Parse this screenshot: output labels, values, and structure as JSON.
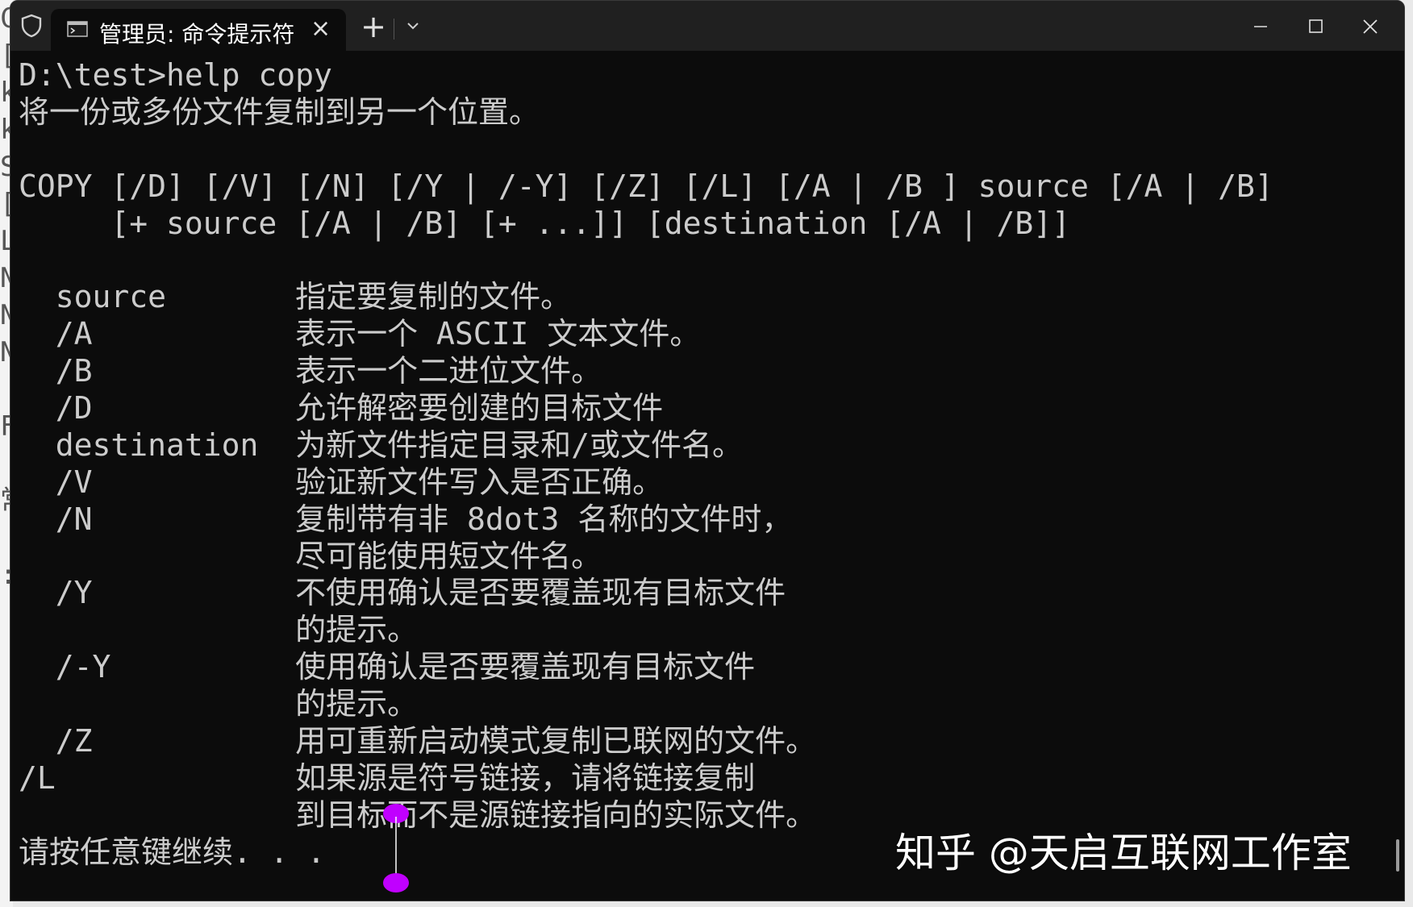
{
  "background_strip": [
    "C",
    "[",
    "k",
    "k",
    "S",
    "[",
    "L",
    "N",
    "N",
    "N",
    "",
    "F",
    "",
    "常",
    "",
    ":",
    "",
    ""
  ],
  "window": {
    "tab_title": "管理员: 命令提示符",
    "tab_close_glyph": "×",
    "new_tab_glyph": "+"
  },
  "console": {
    "lines": [
      "D:\\test>help copy",
      "将一份或多份文件复制到另一个位置。",
      "",
      "COPY [/D] [/V] [/N] [/Y | /-Y] [/Z] [/L] [/A | /B ] source [/A | /B]",
      "     [+ source [/A | /B] [+ ...]] [destination [/A | /B]]",
      "",
      "  source       指定要复制的文件。",
      "  /A           表示一个 ASCII 文本文件。",
      "  /B           表示一个二进位文件。",
      "  /D           允许解密要创建的目标文件",
      "  destination  为新文件指定目录和/或文件名。",
      "  /V           验证新文件写入是否正确。",
      "  /N           复制带有非 8dot3 名称的文件时，",
      "               尽可能使用短文件名。",
      "  /Y           不使用确认是否要覆盖现有目标文件",
      "               的提示。",
      "  /-Y          使用确认是否要覆盖现有目标文件",
      "               的提示。",
      "  /Z           用可重新启动模式复制已联网的文件。",
      "/L             如果源是符号链接，请将链接复制",
      "               到目标而不是源链接指向的实际文件。",
      "请按任意键继续. . ."
    ]
  },
  "watermark": "知乎 @天启互联网工作室",
  "colors": {
    "console_bg": "#0c0c0c",
    "console_fg": "#cccccc",
    "titlebar_bg": "#202020",
    "cursor_marker": "#c000ff"
  }
}
